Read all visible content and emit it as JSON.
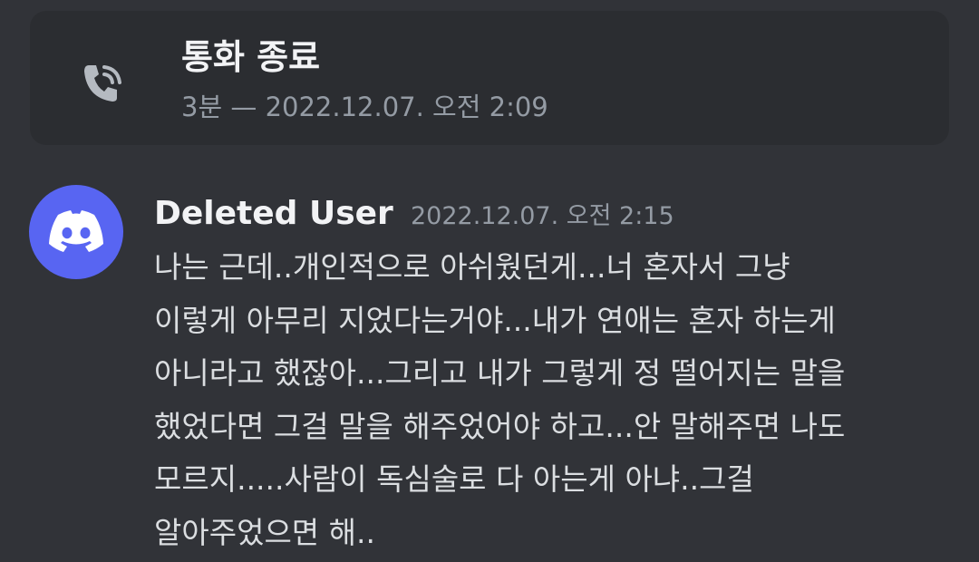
{
  "call": {
    "title": "통화 종료",
    "meta": "3분 — 2022.12.07. 오전 2:09",
    "icon": "phone-call-icon"
  },
  "message": {
    "author": "Deleted User",
    "timestamp": "2022.12.07. 오전 2:15",
    "avatar_icon": "discord-logo-icon",
    "avatar_color": "#5865f2",
    "lines": [
      "나는 근데..개인적으로 아쉬웠던게...너 혼자서 그냥",
      "이렇게 아무리 지었다는거야...내가 연애는 혼자 하는게",
      "아니라고 했잖아...그리고 내가 그렇게 정 떨어지는 말을",
      "했었다면 그걸 말을 해주었어야 하고...안 말해주면 나도",
      "모르지.....사람이 독심술로 다 아는게 아냐..그걸",
      "알아주었으면 해.."
    ]
  },
  "colors": {
    "background": "#313338",
    "card": "#2b2d31",
    "muted_text": "#949ba4",
    "primary_text": "#f2f3f5"
  }
}
